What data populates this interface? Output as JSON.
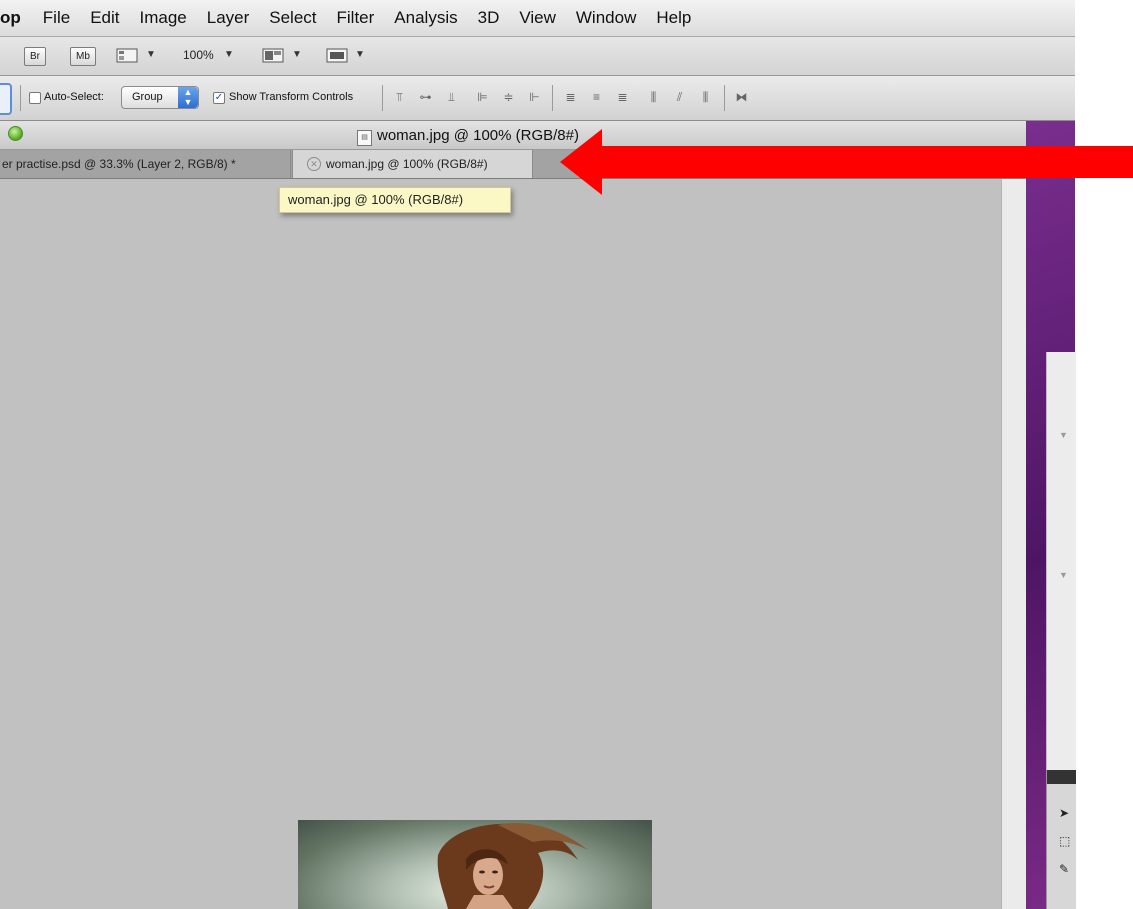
{
  "menubar": {
    "app_fragment": "op",
    "items": [
      "File",
      "Edit",
      "Image",
      "Layer",
      "Select",
      "Filter",
      "Analysis",
      "3D",
      "View",
      "Window",
      "Help"
    ]
  },
  "appbar": {
    "bridge_label": "Br",
    "minibridge_label": "Mb",
    "zoom_value": "100%"
  },
  "options": {
    "auto_select_label": "Auto-Select:",
    "auto_select_value": "Group",
    "show_transform_label": "Show Transform Controls"
  },
  "document": {
    "window_title": "woman.jpg @ 100% (RGB/8#)",
    "tabs": [
      {
        "label": "er practise.psd @ 33.3% (Layer 2, RGB/8) *"
      },
      {
        "label": "woman.jpg @ 100% (RGB/8#)"
      }
    ],
    "tooltip": "woman.jpg @ 100% (RGB/8#)"
  },
  "colors": {
    "arrow": "#ff0000",
    "desktop_purple": "#5a1a72",
    "canvas_gray": "#c1c1c1"
  }
}
